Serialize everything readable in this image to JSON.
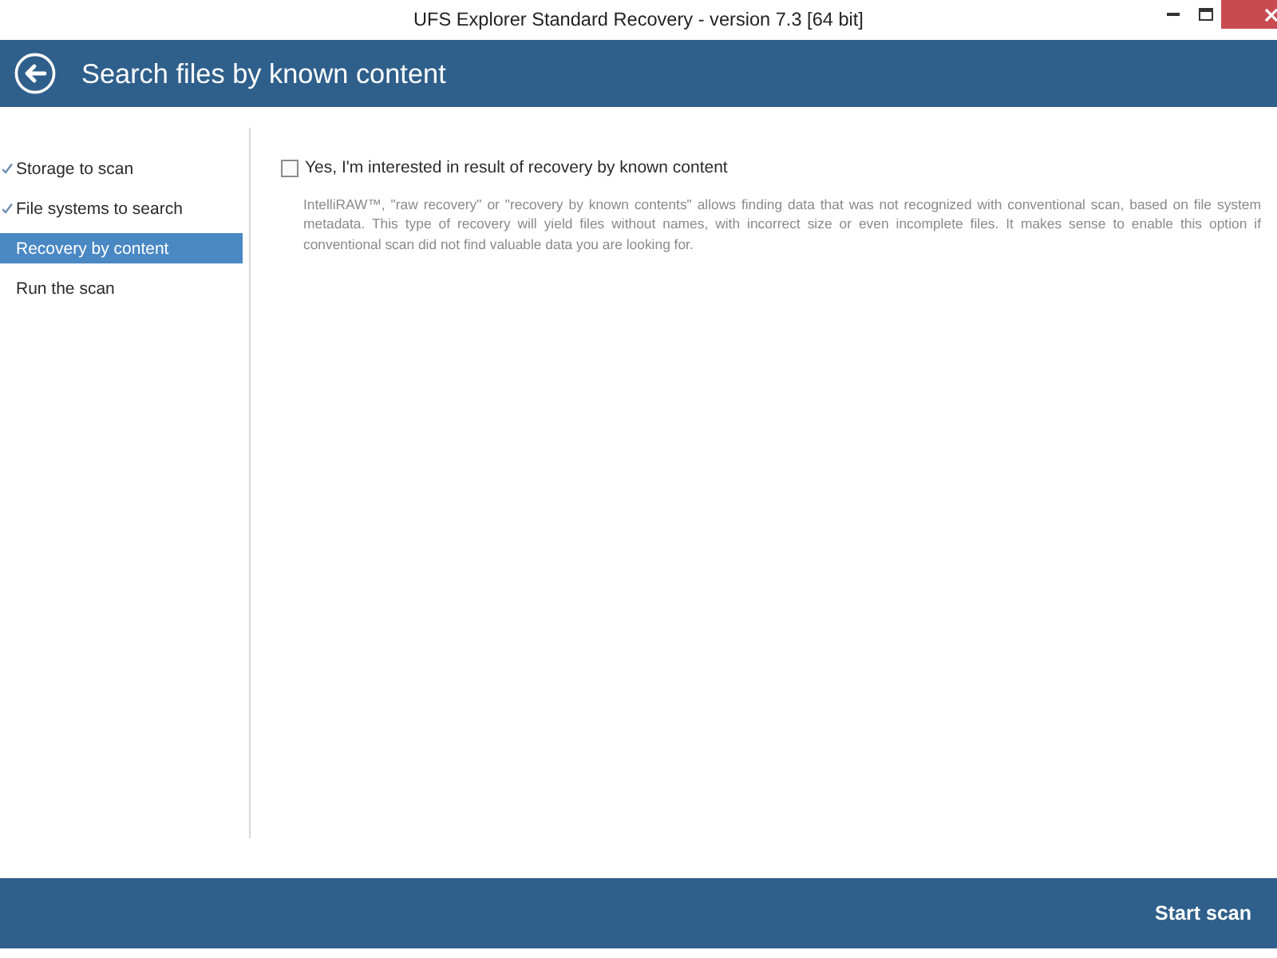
{
  "window": {
    "title": "UFS Explorer Standard Recovery - version 7.3 [64 bit]"
  },
  "header": {
    "title": "Search files by known content"
  },
  "steps": [
    {
      "label": "Storage to scan",
      "done": true,
      "selected": false
    },
    {
      "label": "File systems to search",
      "done": true,
      "selected": false
    },
    {
      "label": "Recovery by content",
      "done": false,
      "selected": true
    },
    {
      "label": "Run the scan",
      "done": false,
      "selected": false
    }
  ],
  "option": {
    "label": "Yes, I'm interested in result of recovery by known content",
    "checked": false,
    "description": "IntelliRAW™, \"raw recovery\" or \"recovery by known contents\" allows finding data that was not recognized with conventional scan, based on file system metadata. This type of recovery will yield files without names, with incorrect size or even incomplete files. It makes sense to enable this option if conventional scan did not find valuable data you are looking for."
  },
  "footer": {
    "button": "Start scan"
  }
}
